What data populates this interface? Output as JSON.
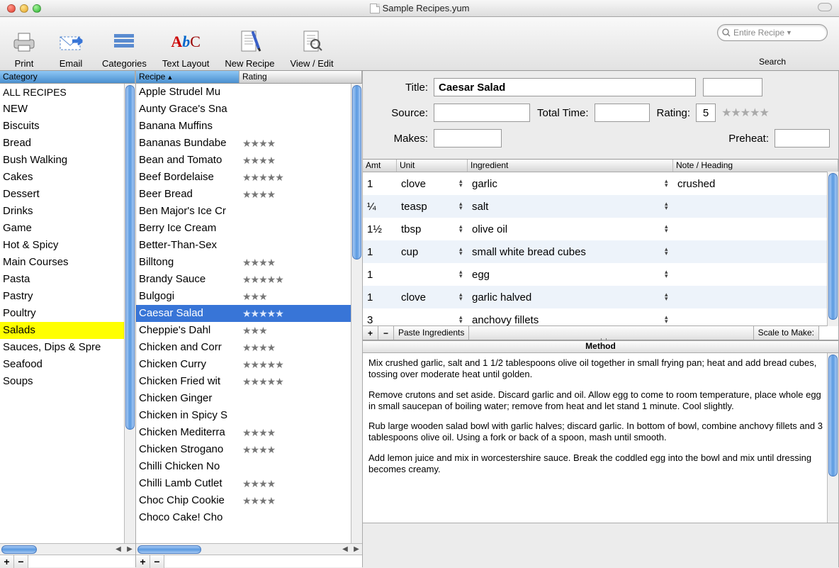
{
  "window": {
    "title": "Sample Recipes.yum"
  },
  "toolbar": {
    "items": [
      {
        "label": "Print"
      },
      {
        "label": "Email"
      },
      {
        "label": "Categories"
      },
      {
        "label": "Text Layout"
      },
      {
        "label": "New Recipe"
      },
      {
        "label": "View / Edit"
      }
    ],
    "search_placeholder": "Entire Recipe",
    "search_label": "Search"
  },
  "category": {
    "header": "Category",
    "items": [
      "ALL RECIPES",
      "NEW",
      "Biscuits",
      "Bread",
      "Bush Walking",
      "Cakes",
      "Dessert",
      "Drinks",
      "Game",
      "Hot & Spicy",
      "Main Courses",
      "Pasta",
      "Pastry",
      "Poultry",
      "Salads",
      "Sauces, Dips & Spre",
      "Seafood",
      "Soups"
    ],
    "selected_index": 14
  },
  "recipes": {
    "headers": {
      "recipe": "Recipe",
      "rating": "Rating"
    },
    "items": [
      {
        "name": "Apple Strudel Mu",
        "stars": 0
      },
      {
        "name": "Aunty Grace's Sna",
        "stars": 0
      },
      {
        "name": "Banana Muffins",
        "stars": 0
      },
      {
        "name": "Bananas Bundabe",
        "stars": 4
      },
      {
        "name": "Bean and Tomato",
        "stars": 4
      },
      {
        "name": "Beef Bordelaise",
        "stars": 5
      },
      {
        "name": "Beer Bread",
        "stars": 4
      },
      {
        "name": "Ben Major's Ice Cr",
        "stars": 0
      },
      {
        "name": "Berry Ice Cream",
        "stars": 0
      },
      {
        "name": "Better-Than-Sex",
        "stars": 0
      },
      {
        "name": "Billtong",
        "stars": 4
      },
      {
        "name": "Brandy Sauce",
        "stars": 5
      },
      {
        "name": "Bulgogi",
        "stars": 3
      },
      {
        "name": "Caesar Salad",
        "stars": 5
      },
      {
        "name": "Cheppie's Dahl",
        "stars": 3
      },
      {
        "name": "Chicken and Corr",
        "stars": 4
      },
      {
        "name": "Chicken Curry",
        "stars": 5
      },
      {
        "name": "Chicken Fried wit",
        "stars": 5
      },
      {
        "name": "Chicken Ginger",
        "stars": 0
      },
      {
        "name": "Chicken in Spicy S",
        "stars": 0
      },
      {
        "name": "Chicken Mediterra",
        "stars": 4
      },
      {
        "name": "Chicken Strogano",
        "stars": 4
      },
      {
        "name": "Chilli Chicken No",
        "stars": 0
      },
      {
        "name": "Chilli Lamb Cutlet",
        "stars": 4
      },
      {
        "name": "Choc Chip Cookie",
        "stars": 4
      },
      {
        "name": "Choco Cake! Cho",
        "stars": 0
      }
    ],
    "selected_index": 13
  },
  "form": {
    "title_label": "Title:",
    "title_value": "Caesar Salad",
    "source_label": "Source:",
    "source_value": "",
    "totaltime_label": "Total Time:",
    "totaltime_value": "",
    "rating_label": "Rating:",
    "rating_value": "5",
    "makes_label": "Makes:",
    "makes_value": "",
    "preheat_label": "Preheat:",
    "preheat_value": ""
  },
  "ingredients": {
    "headers": {
      "amt": "Amt",
      "unit": "Unit",
      "ingredient": "Ingredient",
      "note": "Note / Heading"
    },
    "rows": [
      {
        "amt": "1",
        "unit": "clove",
        "ingredient": "garlic",
        "note": "crushed"
      },
      {
        "amt": "¼",
        "unit": "teasp",
        "ingredient": "salt",
        "note": ""
      },
      {
        "amt": "1½",
        "unit": "tbsp",
        "ingredient": "olive oil",
        "note": ""
      },
      {
        "amt": "1",
        "unit": "cup",
        "ingredient": "small white bread cubes",
        "note": ""
      },
      {
        "amt": "1",
        "unit": "",
        "ingredient": "egg",
        "note": ""
      },
      {
        "amt": "1",
        "unit": "clove",
        "ingredient": "garlic halved",
        "note": ""
      },
      {
        "amt": "3",
        "unit": "",
        "ingredient": "anchovy fillets",
        "note": ""
      }
    ],
    "paste_label": "Paste Ingredients",
    "scale_label": "Scale to Make:"
  },
  "method": {
    "header": "Method",
    "paragraphs": [
      "Mix crushed garlic, salt and 1 1/2 tablespoons olive oil together in small frying pan; heat and add bread cubes, tossing over moderate heat until golden.",
      "Remove crutons and set aside. Discard garlic and oil. Allow egg to come to room temperature, place whole egg in small saucepan of boiling water; remove from heat and let stand 1 minute. Cool slightly.",
      "Rub large wooden salad bowl with garlic halves; discard garlic. In bottom of bowl, combine anchovy fillets and 3 tablespoons olive oil. Using a fork or back of a spoon, mash until smooth.",
      "Add lemon juice and mix in worcestershire sauce. Break the coddled egg into the bowl and mix until dressing becomes creamy."
    ]
  }
}
